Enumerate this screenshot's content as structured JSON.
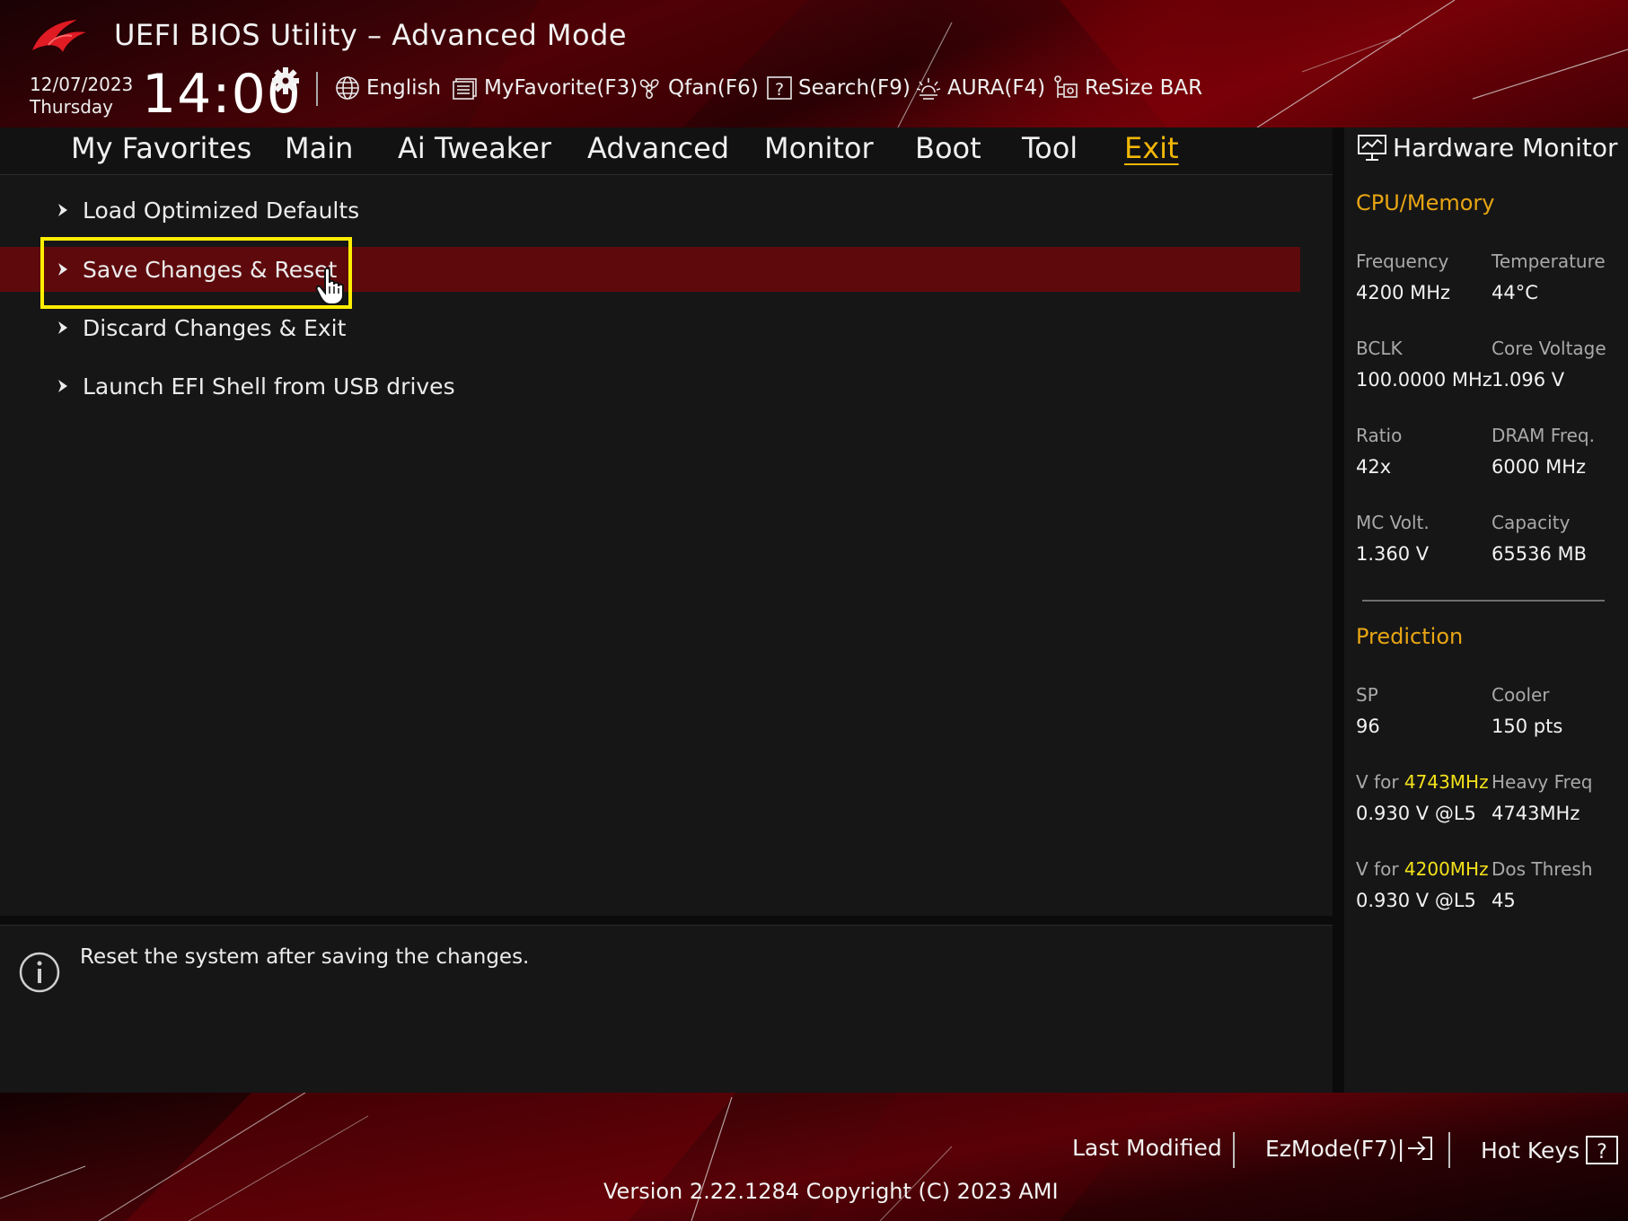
{
  "header": {
    "title": "UEFI BIOS Utility – Advanced Mode",
    "date": "12/07/2023",
    "day": "Thursday",
    "time": "14:00",
    "toolbar": [
      {
        "label": "English",
        "icon": "globe-icon"
      },
      {
        "label": "MyFavorite(F3)",
        "icon": "favorite-list-icon"
      },
      {
        "label": "Qfan(F6)",
        "icon": "fan-icon"
      },
      {
        "label": "Search(F9)",
        "icon": "search-help-icon"
      },
      {
        "label": "AURA(F4)",
        "icon": "aura-light-icon"
      },
      {
        "label": "ReSize BAR",
        "icon": "resize-bar-icon"
      }
    ]
  },
  "tabs": [
    {
      "label": "My Favorites"
    },
    {
      "label": "Main"
    },
    {
      "label": "Ai Tweaker"
    },
    {
      "label": "Advanced"
    },
    {
      "label": "Monitor"
    },
    {
      "label": "Boot"
    },
    {
      "label": "Tool"
    },
    {
      "label": "Exit",
      "active": true
    }
  ],
  "menu": [
    {
      "label": "Load Optimized Defaults"
    },
    {
      "label": "Save Changes & Reset",
      "selected": true
    },
    {
      "label": "Discard Changes & Exit"
    },
    {
      "label": "Launch EFI Shell from USB drives"
    }
  ],
  "help": {
    "text": "Reset the system after saving the changes."
  },
  "hw_monitor": {
    "title": "Hardware Monitor",
    "cpu_memory": {
      "heading": "CPU/Memory",
      "frequency_label": "Frequency",
      "frequency": "4200 MHz",
      "temperature_label": "Temperature",
      "temperature": "44°C",
      "bclk_label": "BCLK",
      "bclk": "100.0000 MHz",
      "core_voltage_label": "Core Voltage",
      "core_voltage": "1.096 V",
      "ratio_label": "Ratio",
      "ratio": "42x",
      "dram_freq_label": "DRAM Freq.",
      "dram_freq": "6000 MHz",
      "mc_volt_label": "MC Volt.",
      "mc_volt": "1.360 V",
      "capacity_label": "Capacity",
      "capacity": "65536 MB"
    },
    "prediction": {
      "heading": "Prediction",
      "sp_label": "SP",
      "sp": "96",
      "cooler_label": "Cooler",
      "cooler": "150 pts",
      "v_for_label_prefix": "V for ",
      "v_for_1_freq": "4743MHz",
      "v_for_1": "0.930 V @L5",
      "heavy_freq_label": "Heavy Freq",
      "heavy_freq": "4743MHz",
      "v_for_2_freq": "4200MHz",
      "v_for_2": "0.930 V @L5",
      "dos_thresh_label": "Dos Thresh",
      "dos_thresh": "45"
    }
  },
  "footer": {
    "last_modified": "Last Modified",
    "ezmode": "EzMode(F7)|",
    "hotkeys": "Hot Keys",
    "version": "Version 2.22.1284 Copyright (C) 2023 AMI"
  },
  "colors": {
    "accent": "#f2b705",
    "selection": "#5e0a0d",
    "highlight_box": "#ffee00",
    "section_heading": "#e8a513",
    "prediction_freq": "#f5e11a"
  }
}
